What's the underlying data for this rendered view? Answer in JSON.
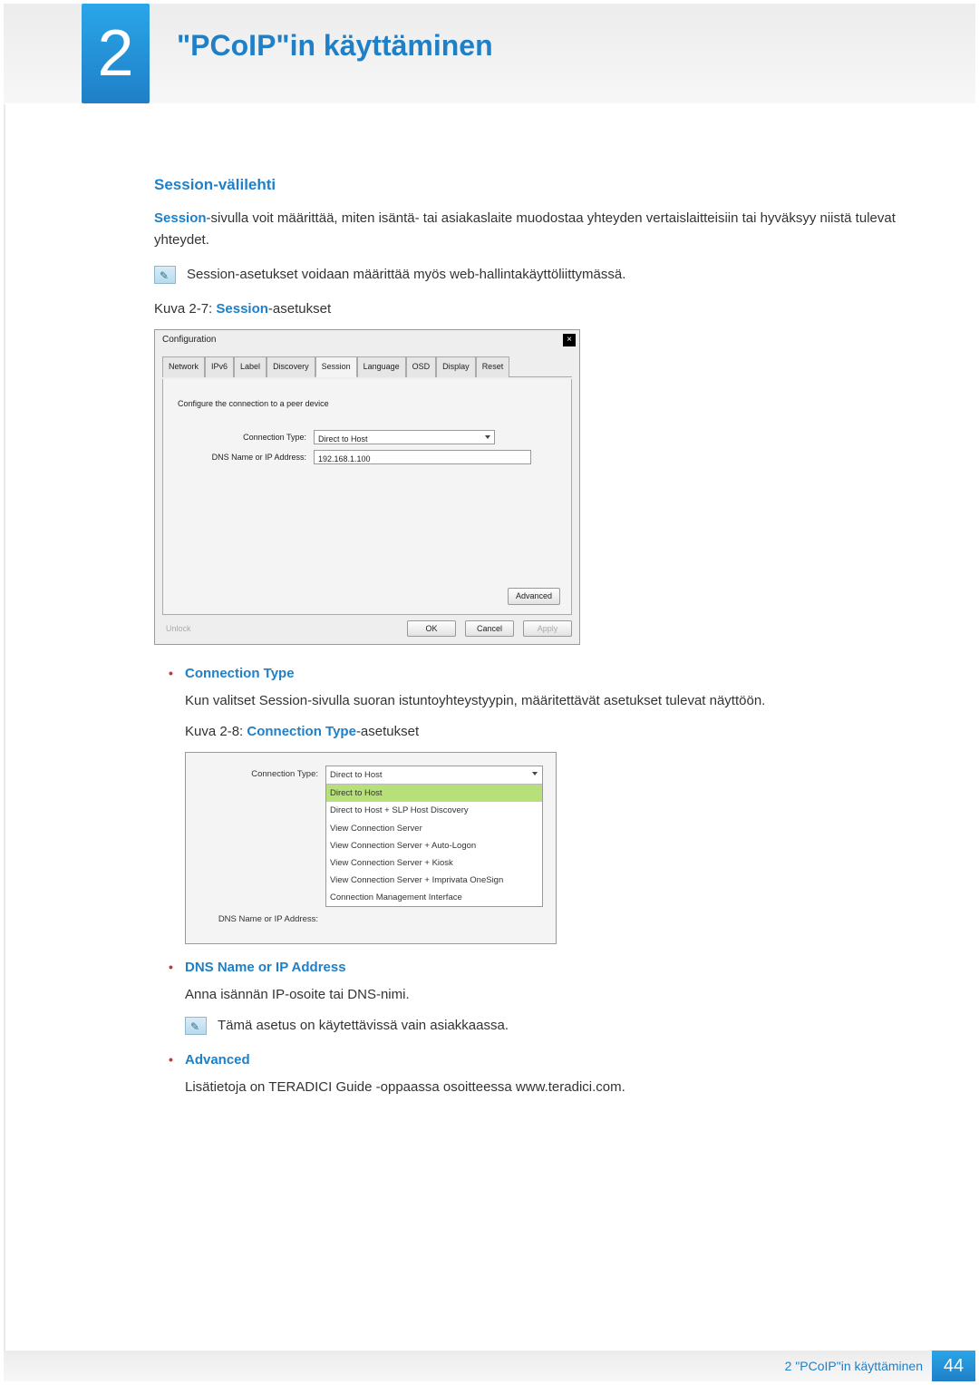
{
  "chapter": {
    "number": "2",
    "title": "\"PCoIP\"in käyttäminen"
  },
  "section": {
    "title": "Session-välilehti",
    "intro_strong": "Session",
    "intro_rest": "-sivulla voit määrittää, miten isäntä- tai asiakaslaite muodostaa yhteyden vertaislaitteisiin tai hyväksyy niistä tulevat yhteydet.",
    "note1": "Session-asetukset voidaan määrittää myös web-hallintakäyttöliittymässä."
  },
  "fig27": {
    "caption_prefix": "Kuva 2-7: ",
    "caption_name": "Session",
    "caption_suffix": "-asetukset",
    "dialog_title": "Configuration",
    "tabs": [
      "Network",
      "IPv6",
      "Label",
      "Discovery",
      "Session",
      "Language",
      "OSD",
      "Display",
      "Reset"
    ],
    "active_tab_index": 4,
    "instruction": "Configure the connection to a peer device",
    "labels": {
      "conn_type": "Connection Type:",
      "dns": "DNS Name or IP Address:"
    },
    "values": {
      "conn_type": "Direct to Host",
      "dns": "192.168.1.100"
    },
    "buttons": {
      "advanced": "Advanced",
      "unlock": "Unlock",
      "ok": "OK",
      "cancel": "Cancel",
      "apply": "Apply"
    }
  },
  "bullet1": {
    "head": "Connection Type",
    "body": "Kun valitset Session-sivulla suoran istuntoyhteystyypin, määritettävät asetukset tulevat näyttöön."
  },
  "fig28": {
    "caption_prefix": "Kuva 2-8: ",
    "caption_name": "Connection Type",
    "caption_suffix": "-asetukset",
    "labels": {
      "conn_type": "Connection Type:",
      "dns": "DNS Name or IP Address:"
    },
    "selected": "Direct to Host",
    "options": [
      "Direct to Host",
      "Direct to Host + SLP Host Discovery",
      "View Connection Server",
      "View Connection Server + Auto-Logon",
      "View Connection Server + Kiosk",
      "View Connection Server + Imprivata OneSign",
      "Connection Management Interface"
    ],
    "highlight_index": 0
  },
  "bullet2": {
    "head": "DNS Name or IP Address",
    "body": "Anna isännän IP-osoite tai DNS-nimi.",
    "note": "Tämä asetus on käytettävissä vain asiakkaassa."
  },
  "bullet3": {
    "head": "Advanced",
    "body": "Lisätietoja on TERADICI Guide -oppaassa osoitteessa www.teradici.com."
  },
  "footer": {
    "text": "2 \"PCoIP\"in käyttäminen",
    "page": "44"
  }
}
